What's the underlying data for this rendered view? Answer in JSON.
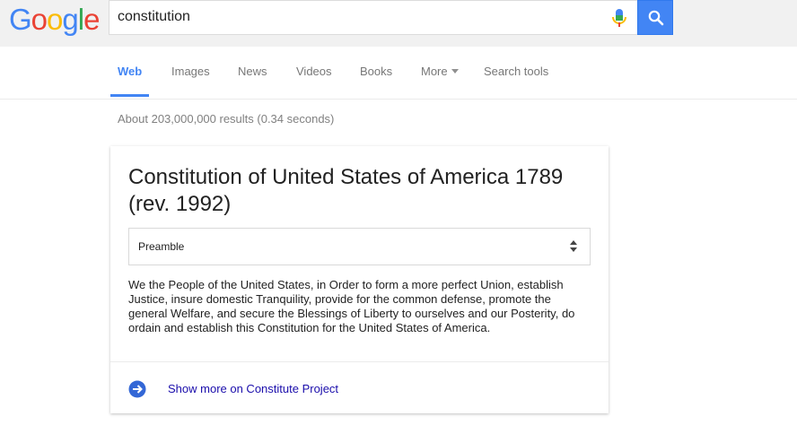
{
  "logo": {
    "letters": [
      "G",
      "o",
      "o",
      "g",
      "l",
      "e"
    ],
    "colors": [
      "#4285f4",
      "#ea4335",
      "#fbbc05",
      "#4285f4",
      "#34a853",
      "#ea4335"
    ]
  },
  "search": {
    "value": "constitution"
  },
  "nav": {
    "tabs": [
      {
        "label": "Web",
        "active": true
      },
      {
        "label": "Images"
      },
      {
        "label": "News"
      },
      {
        "label": "Videos"
      },
      {
        "label": "Books"
      },
      {
        "label": "More"
      },
      {
        "label": "Search tools"
      }
    ]
  },
  "stats": "About 203,000,000 results (0.34 seconds)",
  "card": {
    "title": "Constitution of United States of America 1789 (rev. 1992)",
    "select_value": "Preamble",
    "text": "We the People of the United States, in Order to form a more perfect Union, establish Justice, insure domestic Tranquility, provide for the common defense, promote the general Welfare, and secure the Blessings of Liberty to ourselves and our Posterity, do ordain and establish this Constitution for the United States of America.",
    "more_label": "Show more on Constitute Project"
  },
  "colors": {
    "accent": "#4285f4",
    "link": "#1a0dab",
    "arrow": "#3367d6"
  },
  "icons": {
    "mic": "microphone-icon",
    "search": "magnifier-icon",
    "arrow": "arrow-circle-right-icon"
  }
}
